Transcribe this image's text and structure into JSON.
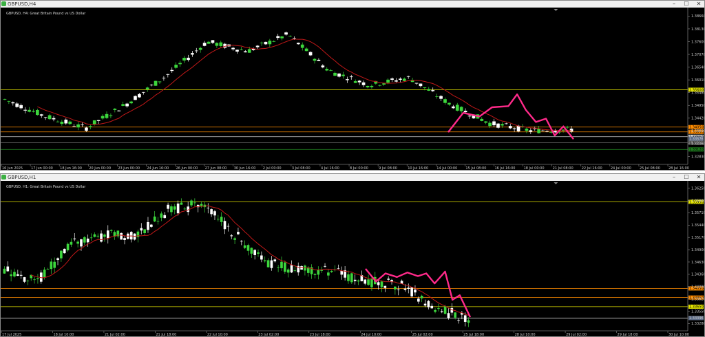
{
  "windows": [
    {
      "title": "GBPUSD,H4",
      "info": "GBPUSD, H4: Great Britain Pound vs US Dollar",
      "controls": [
        "–",
        "☐",
        "✕"
      ],
      "yticks": [
        "1.38660",
        "1.38130",
        "1.37600",
        "1.37070",
        "1.36540",
        "1.36010",
        "1.35480",
        "1.34950",
        "1.34420",
        "1.33890",
        "1.33360",
        "1.32830"
      ],
      "ylim": [
        1.325,
        1.389
      ],
      "xticks": [
        "16 Jun 2025",
        "17 Jun 00:00",
        "18 Jun 16:00",
        "20 Jun 00:00",
        "23 Jun 00:00",
        "24 Jun 16:00",
        "26 Jun 00:00",
        "27 Jun 08:00",
        "30 Jun 16:00",
        "2 Jul 00:00",
        "3 Jul 08:00",
        "4 Jul 16:00",
        "8 Jul 00:00",
        "9 Jul 08:00",
        "10 Jul 16:00",
        "14 Jul 00:00",
        "15 Jul 08:00",
        "16 Jul 16:00",
        "18 Jul 00:00",
        "21 Jul 08:00",
        "22 Jul 16:00",
        "24 Jul 00:00",
        "25 Jul 08:00",
        "28 Jul 16:00"
      ],
      "hlines": [
        {
          "price": 1.356,
          "color": "#e6e600",
          "label": "1.35600"
        },
        {
          "price": 1.3405,
          "color": "#ff8c00",
          "label": "1.34050"
        },
        {
          "price": 1.3385,
          "color": "#ff8c00",
          "label": "1.33850"
        },
        {
          "price": 1.3365,
          "color": "#cfcfcf",
          "label": "1.33650"
        },
        {
          "price": 1.334,
          "color": "#6e6e6e",
          "label": "1.33400"
        },
        {
          "price": 1.3312,
          "color": "#1e7a1e",
          "label": "1.33120"
        }
      ],
      "price_label": {
        "price": 1.3357,
        "text": "1.33576"
      },
      "close_path": [
        1.3384,
        1.3464,
        1.3449,
        1.3487,
        1.3492,
        1.3541,
        1.3476,
        1.3426,
        1.344,
        1.337,
        1.3408,
        1.3355
      ],
      "colors": {
        "bull": "#3cd63c",
        "bear": "#ffffff",
        "ma": "#c01818",
        "zigzag": "#ff2a8a"
      }
    },
    {
      "title": "GBPUSD,H1",
      "info": "GBPUSD, H1: Great Britain Pound vs US Dollar",
      "controls": [
        "–",
        "☐",
        "✕"
      ],
      "yticks": [
        "1.36250",
        "1.35980",
        "1.35710",
        "1.35440",
        "1.35170",
        "1.34900",
        "1.34630",
        "1.34360",
        "1.34090",
        "1.33820",
        "1.33550",
        "1.33280"
      ],
      "ylim": [
        1.3312,
        1.3635
      ],
      "xticks": [
        "17 Jul 2025",
        "18 Jul 10:00",
        "21 Jul 02:00",
        "21 Jul 18:00",
        "22 Jul 10:00",
        "23 Jul 02:00",
        "23 Jul 18:00",
        "24 Jul 10:00",
        "25 Jul 02:00",
        "25 Jul 18:00",
        "28 Jul 10:00",
        "29 Jul 02:00",
        "29 Jul 18:00",
        "30 Jul 10:00"
      ],
      "hlines": [
        {
          "price": 1.3595,
          "color": "#e6e600",
          "label": "1.35950"
        },
        {
          "price": 1.3405,
          "color": "#ff8c00",
          "label": "1.34050"
        },
        {
          "price": 1.3385,
          "color": "#ff8c00",
          "label": "1.33850"
        },
        {
          "price": 1.3365,
          "color": "#e6e600",
          "label": "1.33650"
        },
        {
          "price": 1.334,
          "color": "#cfcfcf",
          "label": "1.33400"
        }
      ],
      "price_label": {
        "price": 1.334,
        "text": "1.33396"
      },
      "close_path": [
        1.3448,
        1.342,
        1.3438,
        1.343,
        1.344,
        1.3432,
        1.3438,
        1.3416,
        1.3442,
        1.338,
        1.339,
        1.3342
      ],
      "colors": {
        "bull": "#3cd63c",
        "bear": "#ffffff",
        "ma": "#c01818",
        "zigzag": "#ff2a8a"
      }
    }
  ]
}
